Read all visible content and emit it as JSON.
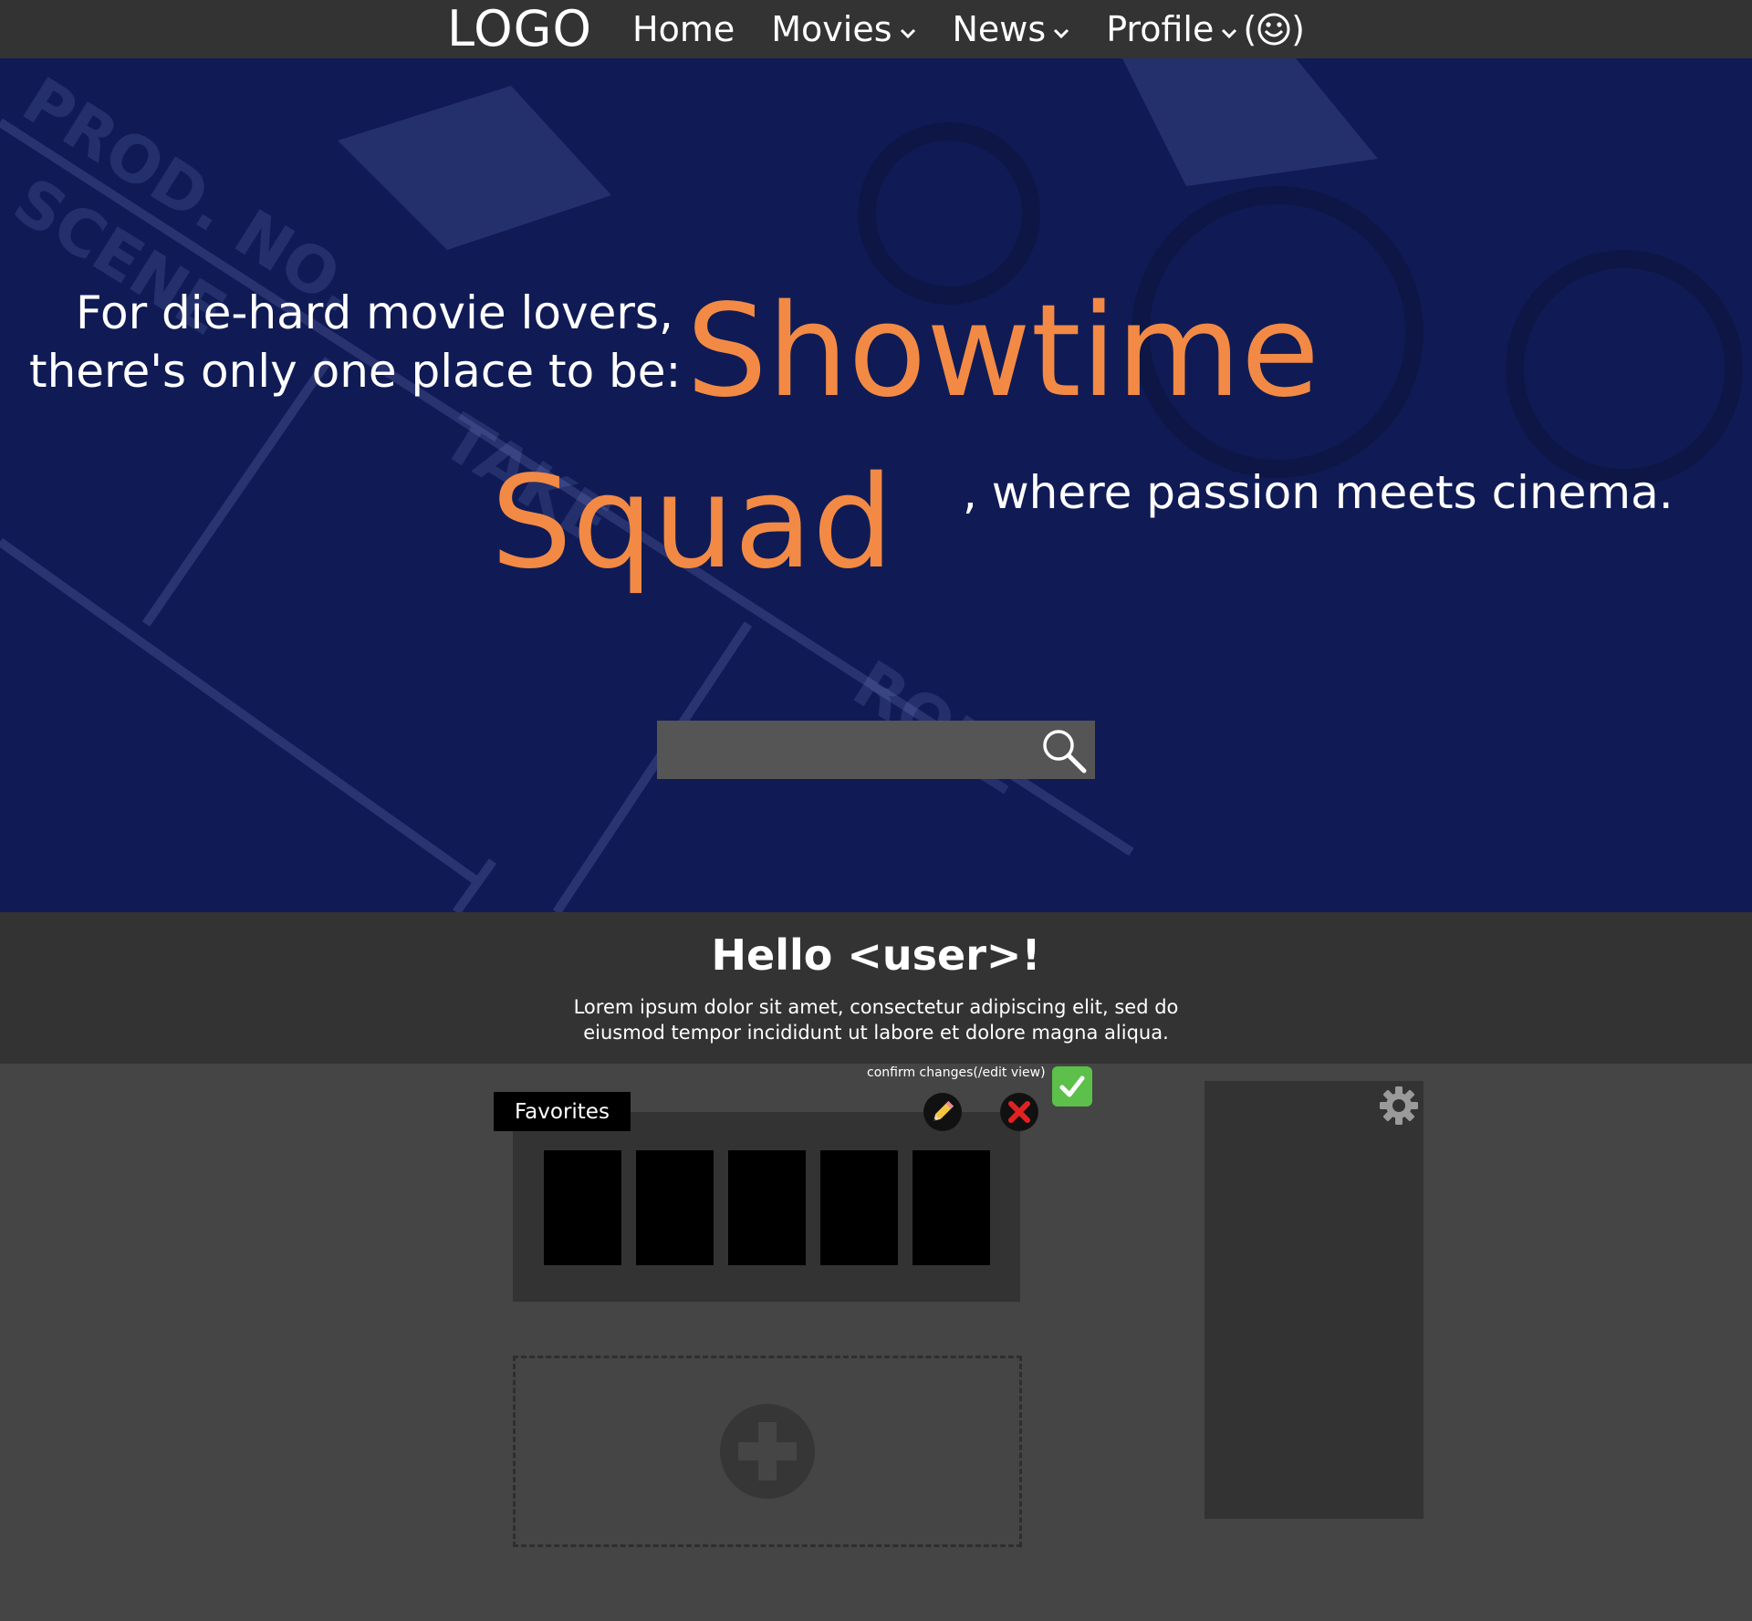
{
  "nav": {
    "logo": "LOGO",
    "items": [
      {
        "label": "Home"
      },
      {
        "label": "Movies"
      },
      {
        "label": "News"
      },
      {
        "label": "Profile"
      }
    ],
    "profile_icon": "smiley-face-icon",
    "profile_parens_open": "(",
    "profile_parens_close": ")"
  },
  "hero": {
    "line1": "For die-hard movie lovers,",
    "line2": "there's only one place to be:",
    "brand_word1": "Showtime",
    "brand_word2": "Squad",
    "line3": ", where passion meets cinema.",
    "search": {
      "placeholder": "",
      "icon": "search-icon"
    },
    "background_icon": "film-clapperboard-background"
  },
  "greeting": {
    "title": "Hello <user>!",
    "body": "Lorem ipsum dolor sit amet, consectetur adipiscing elit, sed do eiusmod tempor incididunt ut labore et dolore magna aliqua."
  },
  "favorites": {
    "tab_label": "Favorites",
    "poster_count": 5,
    "edit_icon": "pencil-icon",
    "cancel_icon": "close-icon",
    "confirm_label": "confirm changes(/edit view)",
    "confirm_icon": "check-icon"
  },
  "add_panel": {
    "icon": "plus-icon"
  },
  "side_panel": {
    "icon": "gear-icon"
  },
  "colors": {
    "navbar": "#333333",
    "hero_bg": "#101b55",
    "brand_orange": "#f28a45",
    "page_bg": "#454545",
    "panel": "#333333",
    "confirm_green": "#5cc04a",
    "cancel_red": "#e22222"
  }
}
